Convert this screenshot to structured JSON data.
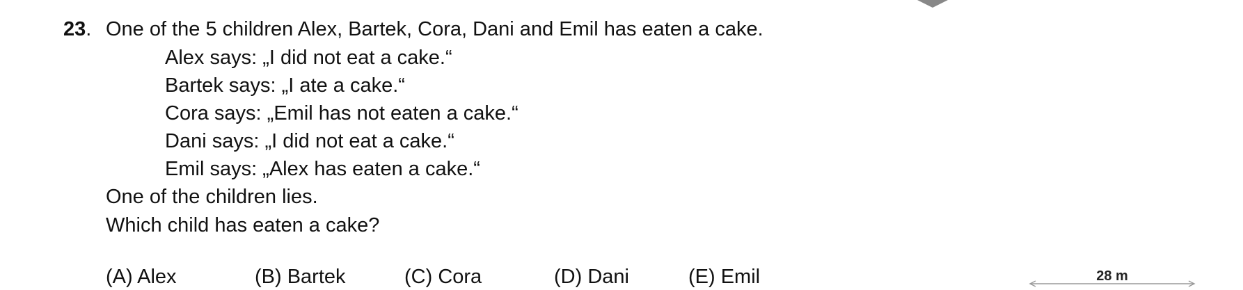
{
  "question": {
    "number": "23",
    "dot": ".",
    "intro": "One of the 5 children Alex, Bartek, Cora, Dani and Emil has eaten a cake.",
    "statements": [
      "Alex says: „I did not eat a cake.“",
      "Bartek says: „I ate a cake.“",
      "Cora says: „Emil has not eaten a cake.“",
      "Dani says: „I did not eat a cake.“",
      "Emil says: „Alex has eaten a cake.“"
    ],
    "lie_line": "One of the children lies.",
    "prompt": "Which child has eaten a cake?"
  },
  "answers": [
    {
      "label": "(A) Alex"
    },
    {
      "label": "(B) Bartek"
    },
    {
      "label": "(C) Cora"
    },
    {
      "label": "(D) Dani"
    },
    {
      "label": "(E) Emil"
    }
  ],
  "distance_indicator": {
    "label": "28 m",
    "color": "#9a9a9a"
  }
}
